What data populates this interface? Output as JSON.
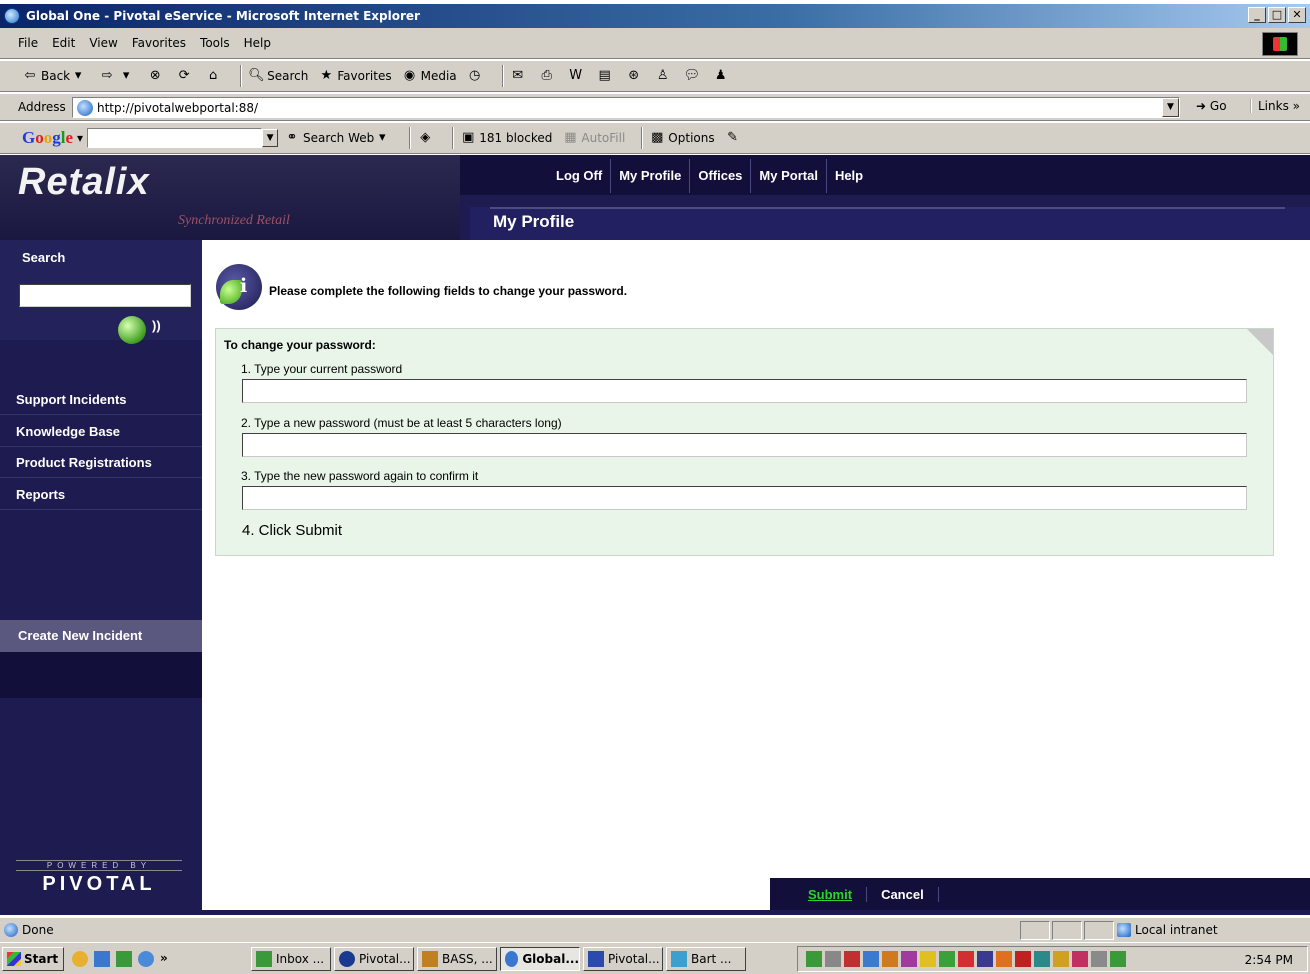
{
  "window": {
    "title": "Global One - Pivotal eService - Microsoft Internet Explorer",
    "controls": [
      "_",
      "□",
      "✕"
    ]
  },
  "menu": [
    "File",
    "Edit",
    "View",
    "Favorites",
    "Tools",
    "Help"
  ],
  "toolbar": {
    "back": "Back",
    "search": "Search",
    "favorites": "Favorites",
    "media": "Media"
  },
  "address": {
    "label": "Address",
    "url": "http://pivotalwebportal:88/",
    "go": "Go",
    "links": "Links"
  },
  "google": {
    "logo": [
      "G",
      "o",
      "o",
      "g",
      "l",
      "e"
    ],
    "search_web": "Search Web",
    "blocked": "181 blocked",
    "autofill": "AutoFill",
    "options": "Options"
  },
  "header": {
    "logo": "Retalix",
    "tagline": "Synchronized Retail",
    "nav": [
      "Log Off",
      "My Profile",
      "Offices",
      "My Portal",
      "Help"
    ],
    "page_title": "My Profile"
  },
  "sidebar": {
    "search_label": "Search",
    "items": [
      "Support Incidents",
      "Knowledge Base",
      "Product Registrations",
      "Reports"
    ],
    "create_new": "Create New Incident",
    "powered_by": "POWERED BY",
    "brand": "PIVOTAL"
  },
  "main": {
    "instruction": "Please complete the following fields to change your password.",
    "form_title": "To change your password:",
    "step1": "1. Type your current password",
    "step2": "2. Type a new password (must be at least 5 characters long)",
    "step3": "3. Type the new password again to confirm it",
    "step4": "4. Click Submit"
  },
  "actions": {
    "submit": "Submit",
    "cancel": "Cancel"
  },
  "status": {
    "text": "Done",
    "zone": "Local intranet"
  },
  "taskbar": {
    "start": "Start",
    "tasks": [
      "Inbox ...",
      "Pivotal...",
      "BASS, ...",
      "Global...",
      "Pivotal...",
      "Bart ..."
    ],
    "clock": "2:54 PM"
  }
}
